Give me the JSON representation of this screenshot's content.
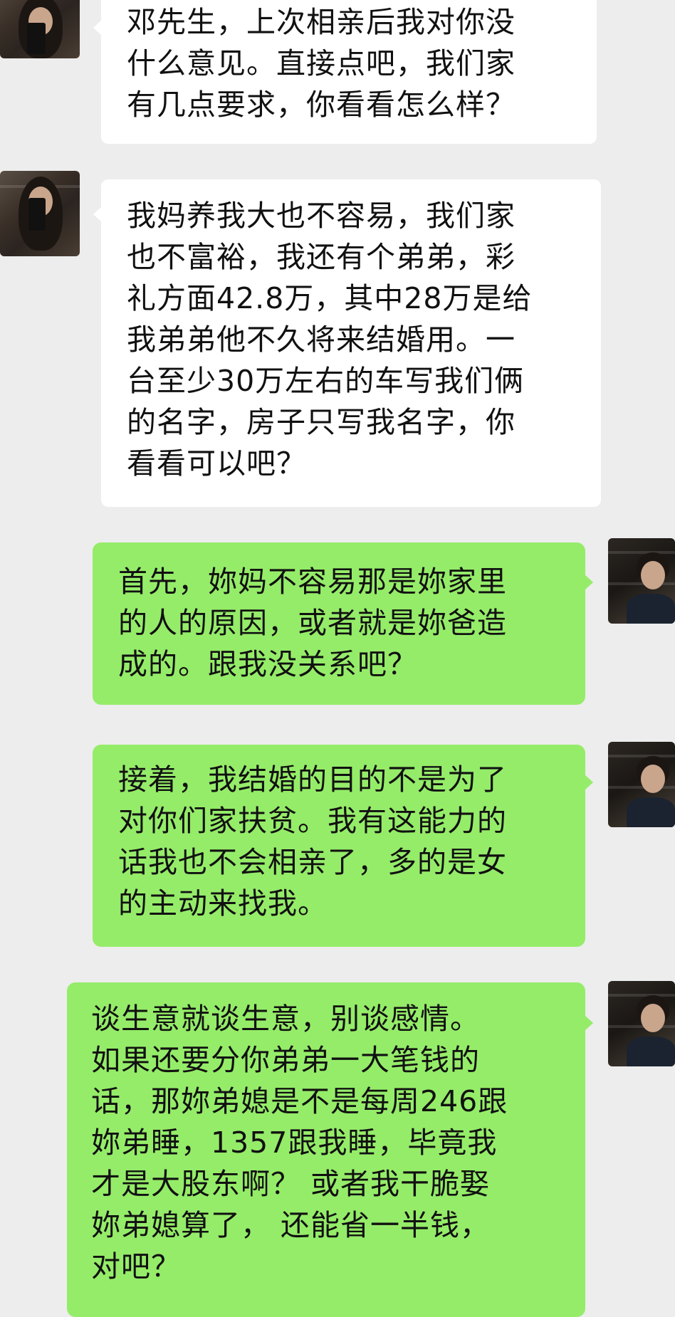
{
  "messages": [
    {
      "sender": "her",
      "text": "邓先生，上次相亲后我对你没\n什么意见。直接点吧，我们家\n有几点要求，你看看怎么样？"
    },
    {
      "sender": "her",
      "text": "我妈养我大也不容易，我们家\n也不富裕，我还有个弟弟，彩\n礼方面42.8万，其中28万是给\n我弟弟他不久将来结婚用。一\n台至少30万左右的车写我们俩\n的名字，房子只写我名字，你\n看看可以吧？"
    },
    {
      "sender": "me",
      "text": "首先，妳妈不容易那是妳家里\n的人的原因，或者就是妳爸造\n成的。跟我没关系吧？"
    },
    {
      "sender": "me",
      "text": "接着，我结婚的目的不是为了\n对你们家扶贫。我有这能力的\n话我也不会相亲了，多的是女\n的主动来找我。"
    },
    {
      "sender": "me",
      "text": "谈生意就谈生意，别谈感情。\n如果还要分你弟弟一大笔钱的\n话，那妳弟媳是不是每周246跟\n妳弟睡，1357跟我睡，毕竟我\n才是大股东啊？ 或者我干脆娶\n妳弟媳算了， 还能省一半钱，\n对吧？"
    }
  ],
  "colors": {
    "background": "#ededed",
    "incoming_bubble": "#ffffff",
    "outgoing_bubble": "#95ec69"
  }
}
